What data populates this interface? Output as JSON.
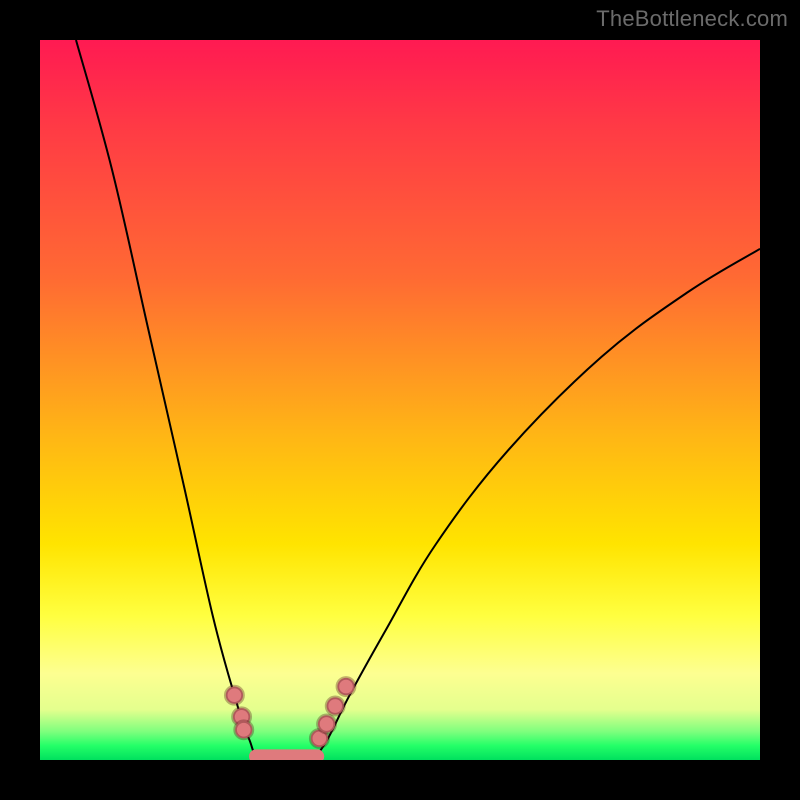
{
  "watermark": "TheBottleneck.com",
  "chart_data": {
    "type": "line",
    "title": "",
    "xlabel": "",
    "ylabel": "",
    "xlim": [
      0,
      100
    ],
    "ylim": [
      0,
      100
    ],
    "grid": false,
    "background_gradient": {
      "direction": "vertical",
      "stops": [
        {
          "pos": 0,
          "color": "#ff1a52"
        },
        {
          "pos": 33,
          "color": "#ff6a33"
        },
        {
          "pos": 70,
          "color": "#ffe400"
        },
        {
          "pos": 88,
          "color": "#fdff91"
        },
        {
          "pos": 100,
          "color": "#00e05e"
        }
      ]
    },
    "series": [
      {
        "name": "left-branch",
        "values": [
          {
            "x": 5,
            "y": 100
          },
          {
            "x": 10,
            "y": 82
          },
          {
            "x": 15,
            "y": 60
          },
          {
            "x": 20,
            "y": 38
          },
          {
            "x": 24,
            "y": 20
          },
          {
            "x": 27,
            "y": 9
          },
          {
            "x": 29,
            "y": 3
          },
          {
            "x": 31,
            "y": 0
          }
        ]
      },
      {
        "name": "flat-bottom",
        "values": [
          {
            "x": 31,
            "y": 0
          },
          {
            "x": 38,
            "y": 0
          }
        ]
      },
      {
        "name": "right-branch",
        "values": [
          {
            "x": 38,
            "y": 0
          },
          {
            "x": 40,
            "y": 3
          },
          {
            "x": 43,
            "y": 9
          },
          {
            "x": 48,
            "y": 18
          },
          {
            "x": 55,
            "y": 30
          },
          {
            "x": 65,
            "y": 43
          },
          {
            "x": 78,
            "y": 56
          },
          {
            "x": 90,
            "y": 65
          },
          {
            "x": 100,
            "y": 71
          }
        ]
      }
    ],
    "highlight_points": [
      {
        "x": 27.0,
        "y": 9.0
      },
      {
        "x": 28.0,
        "y": 6.0
      },
      {
        "x": 28.3,
        "y": 4.2
      },
      {
        "x": 38.8,
        "y": 3.0
      },
      {
        "x": 39.8,
        "y": 5.0
      },
      {
        "x": 41.0,
        "y": 7.5
      },
      {
        "x": 42.5,
        "y": 10.2
      }
    ],
    "flat_highlight": {
      "x1": 30.0,
      "x2": 38.5,
      "y": 0.5
    },
    "highlight_color": "#df7a7d",
    "curve_color": "#000000"
  }
}
